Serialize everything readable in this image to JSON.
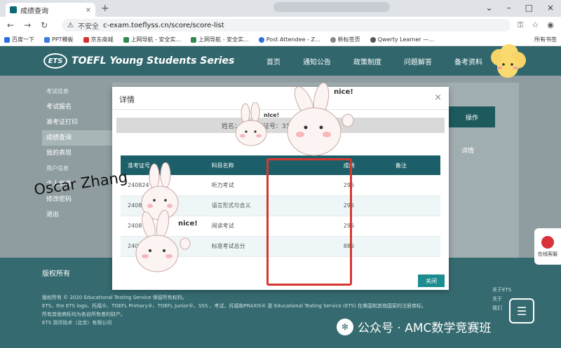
{
  "browser": {
    "tab_title": "成绩查询",
    "new_tab": "+",
    "insecure_label": "不安全",
    "url": "c-exam.toeflyss.cn/score/score-list",
    "bookmarks": [
      "百度一下",
      "PPT模板",
      "京东商城",
      "上网导航 - 安全实...",
      "上网导航 - 安全实...",
      "Post Attendee - Z...",
      "新标签页",
      "Qwerty Learner —..."
    ],
    "bookmarks_all": "所有书签"
  },
  "site": {
    "logo_mark": "ETS",
    "logo_text": "TOEFL Young Students Series",
    "nav": [
      "首页",
      "通知公告",
      "政策制度",
      "问题解答",
      "备考资料"
    ]
  },
  "sidebar": {
    "section1": "考试信息",
    "items": [
      "考试报名",
      "准考证打印",
      "成绩查询",
      "我的表现"
    ],
    "section2": "用户信息",
    "items2": [
      "个人信息",
      "修改密码",
      "退出"
    ]
  },
  "background": {
    "op_head": "操作",
    "op_link": "详情"
  },
  "modal": {
    "title": "详情",
    "close_icon": "×",
    "info_name_label": "姓名：",
    "info_id_label": "准考证号：31",
    "columns": [
      "准考证号",
      "科目名称",
      "成绩",
      "备注"
    ],
    "rows": [
      {
        "id": "240824",
        "subject": "听力考试",
        "score": "295",
        "note": ""
      },
      {
        "id": "240824",
        "subject": "语言形式与含义",
        "score": "295",
        "note": ""
      },
      {
        "id": "2408",
        "subject": "阅读考试",
        "score": "295",
        "note": ""
      },
      {
        "id": "2408",
        "subject": "标准考试总分",
        "score": "885",
        "note": ""
      }
    ],
    "close_button": "关闭"
  },
  "footer": {
    "copyright": "版权所有",
    "line1": "版权所有 © 2020 Educational Testing Service 保留所有权利。",
    "line2": "ETS、the ETS logo、托福®、TOEFL Primary®、TOEFL Junior®、SSS 、考试，托福和PRAXIS® 是 Educational Testing Service (ETS) 在美国和其他国家的注册商标。",
    "line3": "所有其他商标均为各自所有者的财产。",
    "line4": "ETS 测评技术（北京）有限公司",
    "right": [
      "关于ETS",
      "关于",
      "我们"
    ]
  },
  "watermark": "公众号 · AMC数学竞赛班",
  "service_label": "在线客服",
  "signature": "Oscar Zhang",
  "sticker_text": "nice!"
}
